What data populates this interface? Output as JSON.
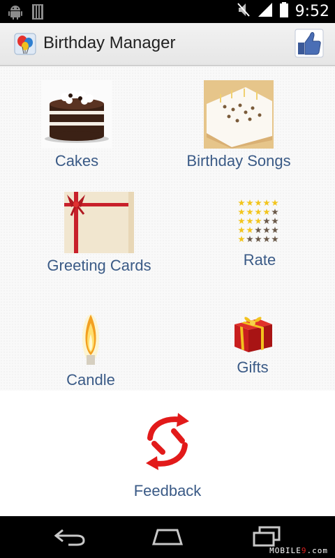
{
  "status_bar": {
    "time": "9:52"
  },
  "app": {
    "title": "Birthday Manager"
  },
  "menu": {
    "cakes": "Cakes",
    "birthday_songs": "Birthday Songs",
    "greeting_cards": "Greeting Cards",
    "rate": "Rate",
    "candle": "Candle",
    "gifts": "Gifts",
    "feedback": "Feedback"
  },
  "watermark": {
    "prefix": "MOBILE",
    "mid": "9",
    "suffix": ".com"
  },
  "icons": [
    "android-icon",
    "sim-icon",
    "mute-icon",
    "signal-icon",
    "battery-icon",
    "balloons-icon",
    "thumbs-up-icon",
    "cake-icon",
    "song-cake-icon",
    "greeting-card-icon",
    "stars-icon",
    "candle-icon",
    "gift-icon",
    "feedback-arrows-icon",
    "back-icon",
    "home-icon",
    "recents-icon"
  ]
}
